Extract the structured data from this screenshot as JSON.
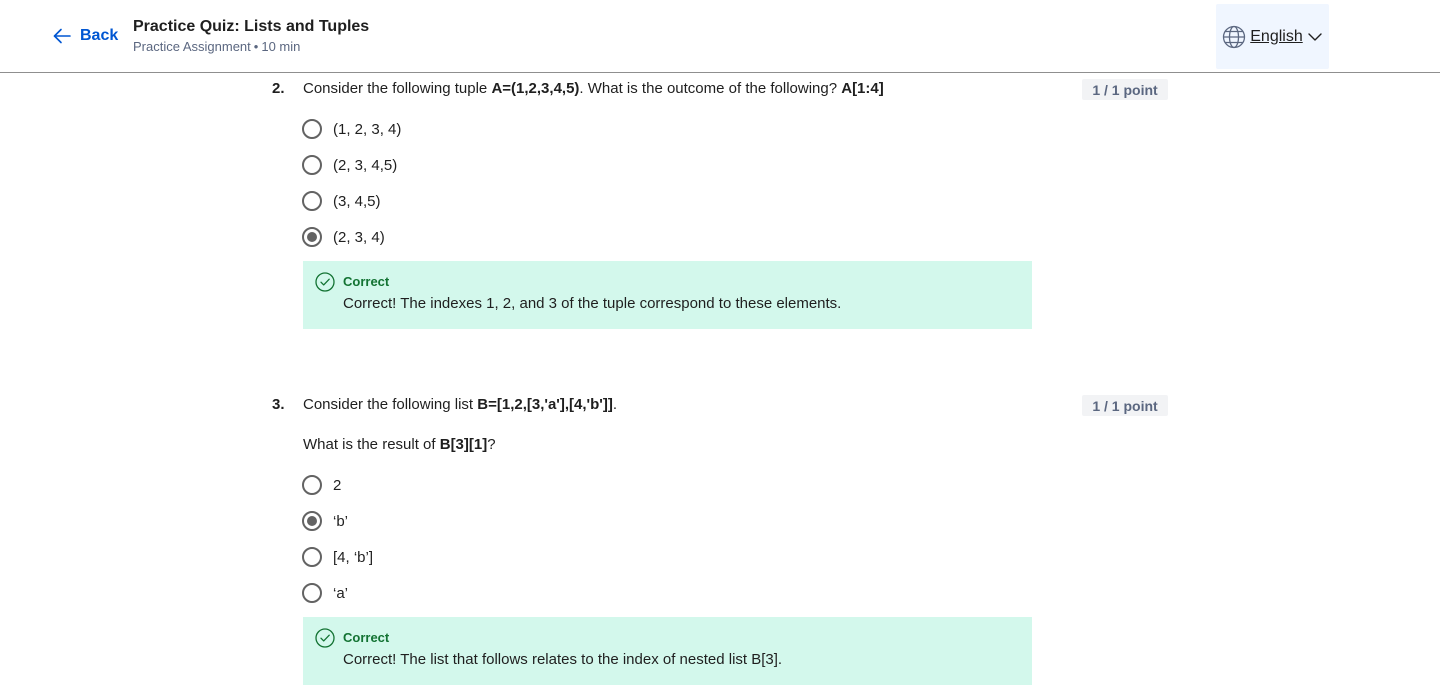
{
  "header": {
    "back_label": "Back",
    "title": "Practice Quiz: Lists and Tuples",
    "subtitle_type": "Practice Assignment",
    "subtitle_separator": "•",
    "subtitle_duration": "10 min",
    "language": "English"
  },
  "questions": [
    {
      "number": "2.",
      "text_prefix": "Consider the following tuple ",
      "text_bold_1": "A=(1,2,3,4,5)",
      "text_middle": ". What is the outcome of the following? ",
      "text_bold_2": "A[1:4]",
      "points": "1 / 1 point",
      "options": [
        "(1, 2, 3, 4)",
        "(2, 3, 4,5)",
        "(3, 4,5)",
        "(2, 3, 4)"
      ],
      "selected_index": 3,
      "feedback_title": "Correct",
      "feedback_text": "Correct! The indexes 1, 2, and 3 of the tuple correspond to these elements."
    },
    {
      "number": "3.",
      "text_prefix": "Consider the following list ",
      "text_bold_1": "B=[1,2,[3,'a'],[4,'b']]",
      "text_suffix": ".",
      "sub_prefix": "What is the result of ",
      "sub_bold": "B[3][1]",
      "sub_suffix": "?",
      "points": "1 / 1 point",
      "options": [
        "2",
        "‘b’",
        "[4, ‘b’]",
        "‘a’"
      ],
      "selected_index": 1,
      "feedback_title": "Correct",
      "feedback_text": "Correct! The list that follows relates to the index of nested list B[3]."
    }
  ],
  "icons": {
    "back": "arrow-left-icon",
    "language": "globe-icon",
    "dropdown": "chevron-down-icon",
    "feedback": "check-circle-icon"
  },
  "colors": {
    "link": "#0056d2",
    "feedback_bg": "#d3f8ec",
    "feedback_title": "#137333",
    "points_bg": "#f2f3f5"
  }
}
